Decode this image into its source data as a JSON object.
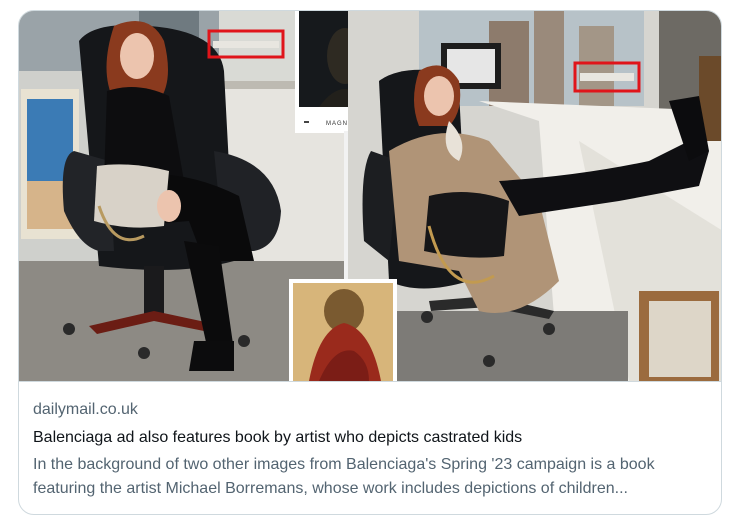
{
  "card": {
    "domain": "dailymail.co.uk",
    "title": "Balenciaga ad also features book by artist who depicts castrated kids",
    "description": "In the background of two other images from Balenciaga's Spring '23 campaign is a book featuring the artist Michael Borremans, whose work includes depictions of children..."
  },
  "image": {
    "inset_book_label": "MAGNETICS"
  },
  "colors": {
    "highlight_box": "#e0141a",
    "border": "#cfd9de",
    "muted_text": "#536471",
    "primary_text": "#0f1419"
  },
  "icons": [
    "highlight-box-icon"
  ]
}
